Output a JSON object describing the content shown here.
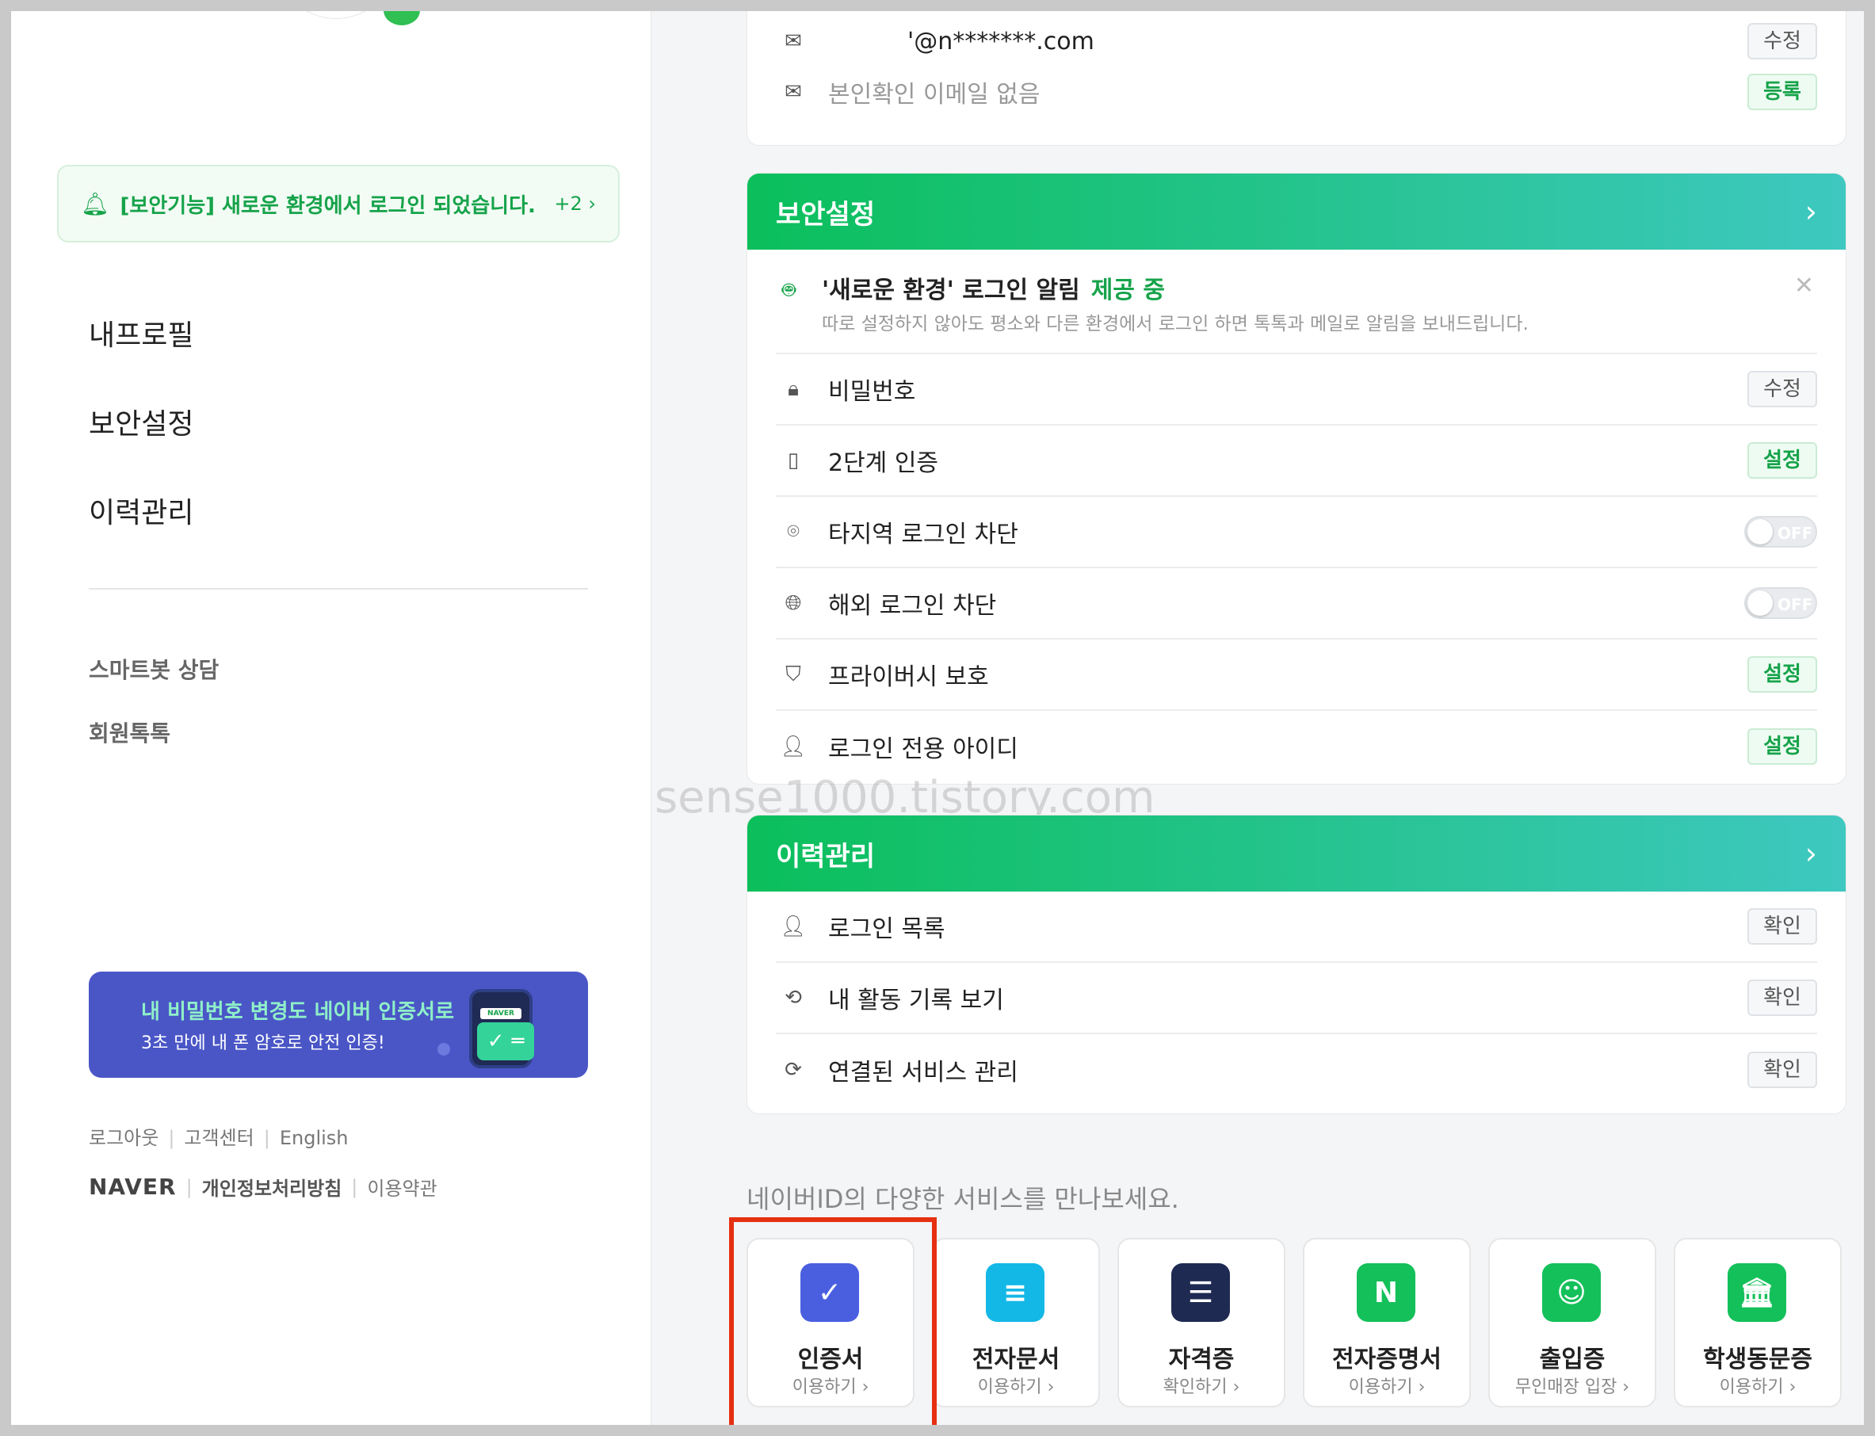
{
  "left": {
    "notice": {
      "text": "[보안기능] 새로운 환경에서 로그인 되었습니다.",
      "more": "+2 ›"
    },
    "nav": [
      "내프로필",
      "보안설정",
      "이력관리"
    ],
    "sub_links": [
      "스마트봇 상담",
      "회원톡톡"
    ],
    "banner": {
      "line1": "내 비밀번호 변경도 네이버 인증서로",
      "line2": "3초 만에 내 폰 암호로 안전 인증!",
      "phone_label": "NAVER"
    },
    "footer1": [
      "로그아웃",
      "고객센터",
      "English"
    ],
    "footer2": {
      "logo": "NAVER",
      "privacy": "개인정보처리방침",
      "terms": "이용약관"
    }
  },
  "contact": {
    "email": "'@n*******.com",
    "email_btn": "수정",
    "verify_email": "본인확인 이메일 없음",
    "verify_btn": "등록"
  },
  "security": {
    "title": "보안설정",
    "alert": {
      "title": "'새로운 환경' 로그인 알림",
      "status": "제공 중",
      "desc": "따로 설정하지 않아도 평소와 다른 환경에서 로그인 하면 톡톡과 메일로 알림을 보내드립니다."
    },
    "rows": [
      {
        "label": "비밀번호",
        "btn": "수정"
      },
      {
        "label": "2단계 인증",
        "btn": "설정"
      },
      {
        "label": "타지역 로그인 차단",
        "toggle": "OFF"
      },
      {
        "label": "해외 로그인 차단",
        "toggle": "OFF"
      },
      {
        "label": "프라이버시 보호",
        "btn": "설정"
      },
      {
        "label": "로그인 전용 아이디",
        "btn": "설정"
      }
    ]
  },
  "history": {
    "title": "이력관리",
    "rows": [
      {
        "label": "로그인 목록",
        "btn": "확인"
      },
      {
        "label": "내 활동 기록 보기",
        "btn": "확인"
      },
      {
        "label": "연결된 서비스 관리",
        "btn": "확인"
      }
    ]
  },
  "watermark": "sense1000.tistory.com",
  "services": {
    "title": "네이버ID의 다양한 서비스를 만나보세요.",
    "items": [
      {
        "name": "인증서",
        "sub": "이용하기 ›",
        "color": "#4a5fe0",
        "icon": "shield-check-icon"
      },
      {
        "name": "전자문서",
        "sub": "이용하기 ›",
        "color": "#14b8e6",
        "icon": "document-icon"
      },
      {
        "name": "자격증",
        "sub": "확인하기 ›",
        "color": "#1e2a52",
        "icon": "certificate-icon"
      },
      {
        "name": "전자증명서",
        "sub": "이용하기 ›",
        "color": "#14c05a",
        "icon": "n-document-icon"
      },
      {
        "name": "출입증",
        "sub": "무인매장 입장 ›",
        "color": "#14c05a",
        "icon": "id-card-icon"
      },
      {
        "name": "학생동문증",
        "sub": "이용하기 ›",
        "color": "#14c05a",
        "icon": "school-icon"
      }
    ]
  },
  "colors": {
    "accent": "#16a34a",
    "highlight": "#e53012"
  }
}
